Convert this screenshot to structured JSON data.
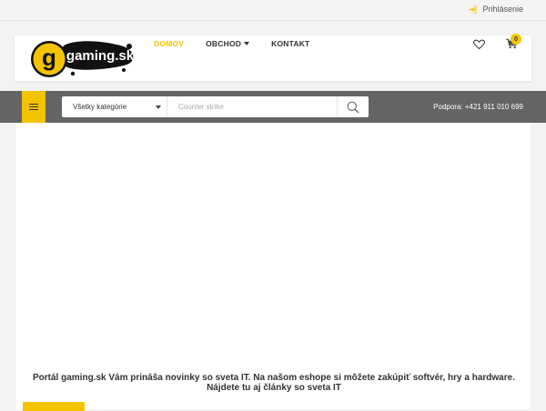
{
  "topbar": {
    "login_label": "Prihlásenie",
    "login_icon": "sign-in-icon"
  },
  "brand": {
    "logo_letter": "g",
    "logo_text": "gaming.sk",
    "accent_color": "#f3c300"
  },
  "nav": {
    "items": [
      {
        "label": "DOMOV",
        "active": true
      },
      {
        "label": "OBCHOD",
        "dropdown": true
      },
      {
        "label": "KONTAKT"
      }
    ]
  },
  "header_icons": {
    "wishlist_icon": "heart-icon",
    "cart_icon": "cart-icon",
    "cart_count": "0"
  },
  "search": {
    "category_selected": "Všetky kategórie",
    "placeholder": "Counter strike",
    "value": ""
  },
  "support": {
    "text": "Podpora: +421 911 010 699"
  },
  "main": {
    "intro_text": "Portál gaming.sk Vám prináša novinky so sveta IT. Na našom eshope si môžete zakúpiť softvér, hry a hardware. Nájdete tu aj články so sveta IT"
  }
}
